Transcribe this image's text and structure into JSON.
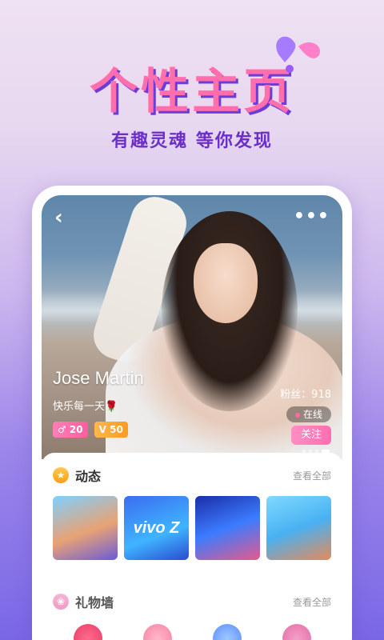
{
  "hero": {
    "title": "个性主页",
    "subtitle": "有趣灵魂 等你发现"
  },
  "profile": {
    "name": "Jose Martin",
    "motto": "快乐每一天🌹",
    "gender_level": "♂ 20",
    "vip_level": "V 50",
    "fans": "粉丝：918",
    "status": "在线",
    "follow_label": "关注",
    "back_icon": "chevron-left-icon",
    "more_icon": "more-dots-icon"
  },
  "moments": {
    "title": "动态",
    "view_all": "查看全部",
    "thumbnails": [
      {
        "label": ""
      },
      {
        "label": "vivo Z"
      },
      {
        "label": ""
      },
      {
        "label": ""
      }
    ]
  },
  "gifts": {
    "title": "礼物墙",
    "view_all": "查看全部"
  },
  "colors": {
    "accent_pink": "#ff6fae",
    "accent_purple": "#6b2fc8",
    "vip_orange": "#ff9a1f"
  }
}
